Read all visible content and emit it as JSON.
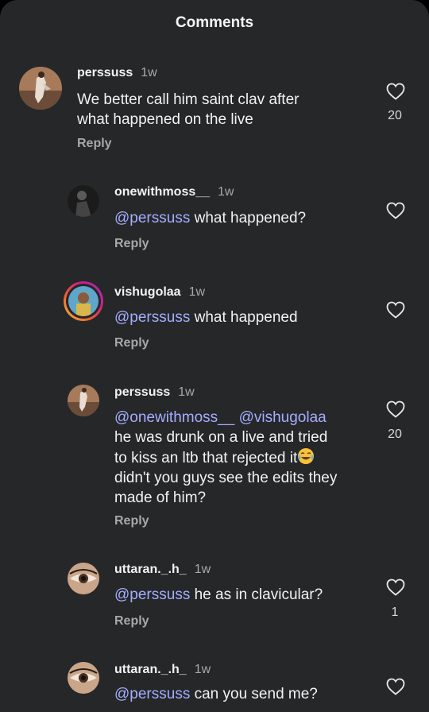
{
  "header": {
    "title": "Comments"
  },
  "comments": [
    {
      "user": "perssuss",
      "time": "1w",
      "lines": [
        "We better call him saint clav after",
        "what happened on the live"
      ],
      "reply": "Reply",
      "likes": "20"
    },
    {
      "user": "onewithmoss__",
      "time": "1w",
      "mention": "@perssuss",
      "text": " what happened?",
      "reply": "Reply",
      "likes": ""
    },
    {
      "user": "vishugolaa",
      "time": "1w",
      "mention": "@perssuss",
      "text": " what happened",
      "reply": "Reply",
      "likes": ""
    },
    {
      "user": "perssuss",
      "time": "1w",
      "mention": "@onewithmoss__ @vishugolaa",
      "line2": "he was drunk on a live and tried",
      "line3": "to kiss an ltb that rejected it",
      "line4": "didn't you guys see the edits they",
      "line5": "made of him?",
      "reply": "Reply",
      "likes": "20"
    },
    {
      "user": "uttaran._.h_",
      "time": "1w",
      "mention": "@perssuss",
      "text": " he as in clavicular?",
      "reply": "Reply",
      "likes": "1"
    },
    {
      "user": "uttaran._.h_",
      "time": "1w",
      "mention": "@perssuss",
      "text": " can you send me?",
      "reply": "",
      "likes": ""
    }
  ],
  "icons": {
    "like": "heart-outline-icon",
    "emoji": "joy-emoji"
  },
  "colors": {
    "background": "#262729",
    "mention": "#a5adff",
    "muted": "#a8a8a8"
  }
}
